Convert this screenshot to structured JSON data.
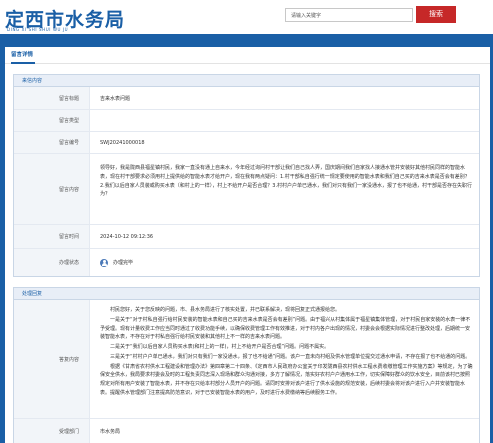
{
  "header": {
    "title": "定西市水务局",
    "subtitle": "DING XI SHI SHUI WU JU",
    "search_placeholder": "请输入关键字",
    "search_button": "搜索"
  },
  "page": {
    "panel_title": "留言详情"
  },
  "message": {
    "section_title": "来信内容",
    "fields": [
      {
        "label": "留言标题",
        "value": "吉来水表问题"
      },
      {
        "label": "留言类型",
        "value": ""
      },
      {
        "label": "留言编号",
        "value": "SWJ20241000018"
      },
      {
        "label": "留言内容",
        "value": "领导好，我是陇西县福星镇村民，我家一直没有通上自来水，今年经过询问村干部让我们自己找人弄，国庆期间我们自家找人接通水管并安装好其他村民同样的智能水表，现在村干部要求必须用村上提供给的智能水表才给开户，现在我有两点疑问：1.村干部私自强行统一规定要使用的智能水表和我们自己买的吉来水表是否会有差别？2.我们以后自家人员装或购买水表（和村上的一样），村上不给开户是否合理？3.村村户户单已通水，我们对只有我们一家没通水，报了也不给通，村干部是否存在失职行为？"
      },
      {
        "label": "留言时间",
        "value": "2024-10-12 09:12:36"
      },
      {
        "label": "办理状态",
        "value": "办理完毕"
      }
    ]
  },
  "reply": {
    "section_title": "处理回复",
    "content_label": "答复内容",
    "paragraphs": [
      "村民您好，关于您反映的问题，市、县水务局进行了核实处置，并已联系解决，现将回复正式通报给您。",
      "一是关于“对于村私自强行给村民安装的智能水表和自己买的吉来水表是否会有差别”问题。由于福兴从村集体属于福星镇集体管理，对于村民自家安装的水表一律不予受理。现有计量收费工作应当同时通过了收费功能手续，以确保收费管理工作有效推进，对于村内各户出现的情况，村委会会根据实际情况进行整改处理，后期统一安装智能水表，不存在对于村私自强行给村民安装和其他村上不一样的吉来水表问题。",
      "二是关于“我们以后自家人员购买水表(和村上的一样)，村上不给开户是否合理”问题。问题不属实。",
      "三是关于“村村户户单已通水，我们对只有我们一家没通水，报了也不给通”问题。该户一直未向村组及供水管理单位提交过通水申请，不存在报了也不给通的问题。",
      "根据《甘肃省农村供水工程建设和管理办法》第四章第二十四条、《定西市人民政府办公室关于印发陇西县农村供水工程水费收缴管理工作实施方案》等规定，为了确保安全供水，我局要求村委会及时的工程负责同志深入现场和群众沟通对接，多方了解情况，落实好农村户户通用水工作，切实保障好群众的饮水安全，目前该村已按照规定对所有用户安装了智能水表，并不存在只给本村部分人员开户的问题。请同时安排对该户进行了供水设施的规范安装，后续村委会将对该户进行入户并安装智能水表。提醒供水管理部门注意提高防范意识，对于已安装智能水表的用户，及时进行水费缴纳等后续服务工作。"
    ],
    "dept_label": "受理部门",
    "dept_value": "市水务局"
  }
}
